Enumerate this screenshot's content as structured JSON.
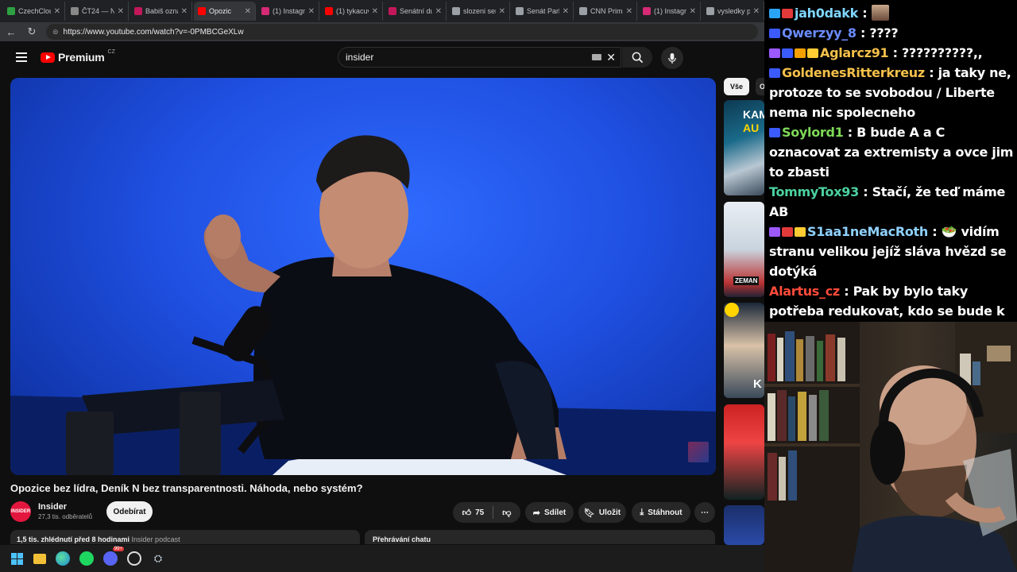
{
  "browser": {
    "tabs": [
      {
        "title": "CzechClou",
        "color": "#2ea043",
        "active": false
      },
      {
        "title": "ČT24 — Ne",
        "color": "#888888",
        "active": false
      },
      {
        "title": "Babiš oznám",
        "color": "#c2185b",
        "active": false
      },
      {
        "title": "Opozic",
        "color": "#ff0000",
        "active": true
      },
      {
        "title": "(1) Instagram",
        "color": "#d62976",
        "active": false
      },
      {
        "title": "(1) tykacuv",
        "color": "#ff0000",
        "active": false
      },
      {
        "title": "Senátní dur",
        "color": "#c2185b",
        "active": false
      },
      {
        "title": "slozeni sena",
        "color": "#9aa0a6",
        "active": false
      },
      {
        "title": "Senát Parlam",
        "color": "#9aa0a6",
        "active": false
      },
      {
        "title": "CNN Prima",
        "color": "#9aa0a6",
        "active": false
      },
      {
        "title": "(1) Instagram",
        "color": "#d62976",
        "active": false
      },
      {
        "title": "vysledky pa",
        "color": "#9aa0a6",
        "active": false
      }
    ],
    "url": "https://www.youtube.com/watch?v=-0PMBCGeXLw"
  },
  "youtube": {
    "brand": "Premium",
    "region": "CZ",
    "search_query": "insider",
    "video_title": "Opozice bez lídra, Deník N bez transparentnosti. Náhoda, nebo systém?",
    "channel": {
      "name": "Insider",
      "avatar_text": "INSIDER",
      "subscribers": "27,3 tis. odběratelů"
    },
    "subscribe_label": "Odebírat",
    "like_count": "75",
    "share_label": "Sdílet",
    "save_label": "Uložit",
    "download_label": "Stáhnout",
    "description_meta": "1,5 tis. zhlédnutí  před 8 hodinami",
    "description_tag": "Insider podcast",
    "chat_replay_label": "Přehrávání chatu",
    "rail": {
      "chip_all": "Vše",
      "chip_next": "O",
      "thumb1_line1": "KAM",
      "thumb1_line2": "AU",
      "thumb2_tag": "ZEMAN",
      "thumb3_letter": "K"
    }
  },
  "chat": {
    "messages": [
      {
        "user": "jah0dakk",
        "color": "#7fd6ff",
        "badges": [
          "#2aa4f4",
          "#e23a3a"
        ],
        "text": ""
      },
      {
        "user": "Qwerzyy_8",
        "color": "#6b8cff",
        "badges": [
          "#3b5bff"
        ],
        "text": "????"
      },
      {
        "user": "Aglarcz91",
        "color": "#f5c04a",
        "badges": [
          "#9b59ff",
          "#3b5bff",
          "#f5a000",
          "#ffcc33"
        ],
        "text": "??????????,,"
      },
      {
        "user": "GoldenesRitterkreuz",
        "color": "#f5c04a",
        "badges": [
          "#3b5bff"
        ],
        "text": "ja taky ne, protoze to se svobodou / Liberte nema nic spolecneho"
      },
      {
        "user": "Soylord1",
        "color": "#7ed957",
        "badges": [
          "#3b5bff"
        ],
        "text": "B bude A a C oznacovat za extremisty a ovce jim to zbasti"
      },
      {
        "user": "TommyTox93",
        "color": "#4cd1a0",
        "badges": [],
        "text": "Stačí, že teď máme AB"
      },
      {
        "user": "S1aa1neMacRoth",
        "color": "#8fd1ff",
        "badges": [
          "#9b59ff",
          "#e23a3a",
          "#ffcc33"
        ],
        "text": "🥗 vidím stranu velikou jejíž sláva hvězd se dotýká"
      },
      {
        "user": "Alartus_cz",
        "color": "#ff4a3a",
        "badges": [],
        "text": "Pak by bylo taky potřeba redukovat, kdo se bude k politice veřejně vyjadřovat. To by se ti asi už tak nelíbilo."
      }
    ]
  },
  "taskbar": {
    "icons": [
      "windows-start-icon",
      "file-explorer-icon",
      "edge-browser-icon",
      "spotify-icon",
      "discord-icon",
      "obs-icon",
      "steam-icon"
    ],
    "discord_badge": "99+"
  }
}
